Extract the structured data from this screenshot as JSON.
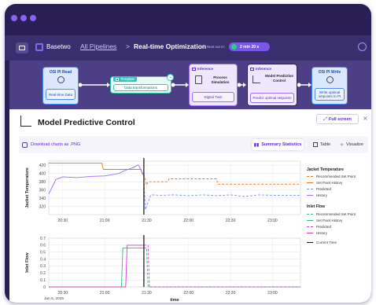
{
  "colors": {
    "window_bg": "#2a1f55",
    "accent": "#8a63f7",
    "history_purple": "#9b6cf4",
    "setpoint_orange": "#e8761c",
    "predicted_blue": "#7d8ff2",
    "inlet_green": "#2dbd6e",
    "inlet_pink": "#cf3ad6",
    "current_time": "#111111"
  },
  "header": {
    "app_name": "Basetwo",
    "breadcrumb_root": "All Pipelines",
    "breadcrumb_sep": ">",
    "page_title": "Real-time Optimization",
    "next_run_label": "Next run in:",
    "next_run_value": "2 min 20 s"
  },
  "pipeline": {
    "nodes": [
      {
        "tag": "OSI PI Read",
        "label": "Real-time Data",
        "tag_icon": "pi-icon"
      },
      {
        "tag": "Template",
        "label": "Data transformations",
        "tag_icon": "template-icon"
      },
      {
        "tag": "Inference",
        "title": "Process Simulation",
        "label": "Digital Twin",
        "tag_icon": "inference-icon"
      },
      {
        "tag": "Inference",
        "title": "Model Predictive Control",
        "label": "Predict optimal setpoints",
        "tag_icon": "inference-icon"
      },
      {
        "tag": "OSI PI Write",
        "label": "Write optimal setpoints to PI",
        "tag_icon": "pi-icon"
      }
    ]
  },
  "panel": {
    "title": "Model Predictive Control",
    "fullscreen_label": "Full screen",
    "download_label": "Download charts as .PNG",
    "tabs": [
      "Summary Statistics",
      "Table",
      "Visualize"
    ]
  },
  "legend": {
    "group1_title": "Jacket Temperature",
    "group1_items": [
      "Recommended Set Point",
      "Set Point History",
      "Predicted",
      "History"
    ],
    "group2_title": "Inlet Flow",
    "group2_items": [
      "Recommended Set Point",
      "Set Point History",
      "Predicted",
      "History"
    ],
    "current_time": "Current Time"
  },
  "chart_data": [
    {
      "type": "line",
      "ylabel": "Jacket Temperature",
      "ylim": [
        300,
        430
      ],
      "yticks": [
        "420",
        "400",
        "380",
        "360",
        "340",
        "320"
      ],
      "xticks": [
        "20:30",
        "21:00",
        "21:30",
        "22:00",
        "22:30",
        "23:00"
      ],
      "current_time": "21:28",
      "series": [
        {
          "name": "Set Point History",
          "x": [
            "20:20",
            "20:58",
            "20:59",
            "21:26",
            "21:27",
            "21:28"
          ],
          "y": [
            425,
            425,
            410,
            410,
            398,
            398
          ]
        },
        {
          "name": "History",
          "x": [
            "20:20",
            "20:25",
            "20:30",
            "20:40",
            "20:50",
            "21:00",
            "21:10",
            "21:15",
            "21:20",
            "21:24",
            "21:26",
            "21:28"
          ],
          "y": [
            350,
            385,
            392,
            390,
            393,
            394,
            400,
            408,
            414,
            421,
            408,
            395
          ]
        },
        {
          "name": "Recommended Set Point",
          "x": [
            "21:28",
            "21:30",
            "21:31",
            "21:45",
            "21:46",
            "22:20",
            "22:21",
            "23:20"
          ],
          "y": [
            398,
            372,
            380,
            380,
            387,
            387,
            374,
            374
          ]
        },
        {
          "name": "Predicted",
          "x": [
            "21:28",
            "21:29",
            "21:31",
            "21:33",
            "21:40",
            "21:50",
            "22:00",
            "22:10",
            "22:20",
            "22:30",
            "22:40",
            "22:50",
            "23:00",
            "23:10",
            "23:20"
          ],
          "y": [
            395,
            312,
            330,
            348,
            347,
            348,
            346,
            348,
            346,
            348,
            344,
            348,
            347,
            347,
            347
          ]
        }
      ]
    },
    {
      "type": "line",
      "ylabel": "Inlet Flow",
      "xlabel": "time",
      "ylim": [
        0,
        0.7
      ],
      "yticks": [
        "0.7",
        "0.6",
        "0.5",
        "0.4",
        "0.3",
        "0.2",
        "0.1",
        "0"
      ],
      "xticks": [
        "20:30",
        "21:00",
        "21:30",
        "22:00",
        "22:30",
        "23:00"
      ],
      "date_label": "Jan 5, 2025",
      "current_time": "21:28",
      "series": [
        {
          "name": "Set Point History",
          "x": [
            "20:20",
            "21:12",
            "21:13",
            "21:28"
          ],
          "y": [
            0,
            0,
            0.56,
            0.56
          ]
        },
        {
          "name": "History",
          "x": [
            "20:20",
            "21:15",
            "21:16",
            "21:28"
          ],
          "y": [
            0,
            0,
            0.6,
            0.6
          ]
        },
        {
          "name": "Recommended Set Point",
          "x": [
            "21:28",
            "21:30",
            "21:31",
            "23:20"
          ],
          "y": [
            0.56,
            0.56,
            0,
            0
          ]
        },
        {
          "name": "Predicted",
          "x": [
            "21:28",
            "21:31",
            "21:32",
            "23:20"
          ],
          "y": [
            0.6,
            0.6,
            0,
            0
          ]
        }
      ]
    }
  ]
}
